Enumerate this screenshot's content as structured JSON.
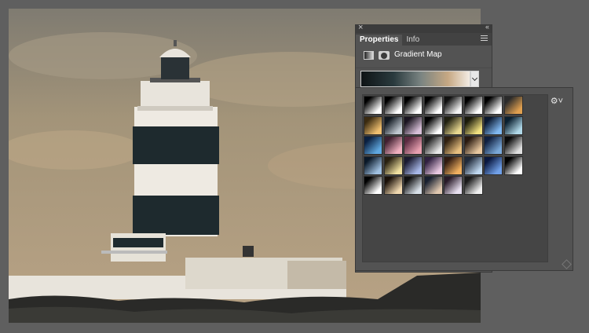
{
  "panel": {
    "tabs": [
      "Properties",
      "Info"
    ],
    "header_title": "Gradient Map"
  },
  "gradients": [
    [
      "#000000",
      "#ffffff"
    ],
    [
      "#000000",
      "#ffffff"
    ],
    [
      "#000000",
      "#ffffff"
    ],
    [
      "#000000",
      "#ffffff"
    ],
    [
      "#111111",
      "#f4f4f4"
    ],
    [
      "#000000",
      "#ffffff"
    ],
    [
      "#000000",
      "#ffffff"
    ],
    [
      "#2a2a2a",
      "#e0a050"
    ],
    [
      "#3a2a10",
      "#f0c070"
    ],
    [
      "#101820",
      "#c0c8d0"
    ],
    [
      "#1a1420",
      "#d8c0d8"
    ],
    [
      "#000000",
      "#ffffff"
    ],
    [
      "#202010",
      "#e8d890"
    ],
    [
      "#1a1a0a",
      "#f0e080"
    ],
    [
      "#0a1830",
      "#80b8f0"
    ],
    [
      "#0a2030",
      "#b0d8e8"
    ],
    [
      "#0a2040",
      "#60a8e0"
    ],
    [
      "#402030",
      "#f0b0c0"
    ],
    [
      "#5a2a40",
      "#e8a0b0"
    ],
    [
      "#202020",
      "#e8e8e8"
    ],
    [
      "#302010",
      "#e8c080"
    ],
    [
      "#2a1a10",
      "#e8c8a0"
    ],
    [
      "#102040",
      "#7aa8d8"
    ],
    [
      "#0a0a0a",
      "#e0e0e0"
    ],
    [
      "#0a1828",
      "#a0c0e0"
    ],
    [
      "#282010",
      "#f0e0a0"
    ],
    [
      "#1a1a30",
      "#a8b8e8"
    ],
    [
      "#302040",
      "#e8c8e0"
    ],
    [
      "#301a10",
      "#f0b060"
    ],
    [
      "#202a3a",
      "#c0d8f0"
    ],
    [
      "#0a1840",
      "#70a0e8"
    ],
    [
      "#000000",
      "#ffffff"
    ],
    [
      "#000000",
      "#ffffff"
    ],
    [
      "#1a1008",
      "#f0d8b0"
    ],
    [
      "#101010",
      "#d8e0e8"
    ],
    [
      "#182030",
      "#e0c8b0"
    ],
    [
      "#281a28",
      "#e8e0f0"
    ],
    [
      "#1a1a1a",
      "#f0f0f0"
    ]
  ]
}
